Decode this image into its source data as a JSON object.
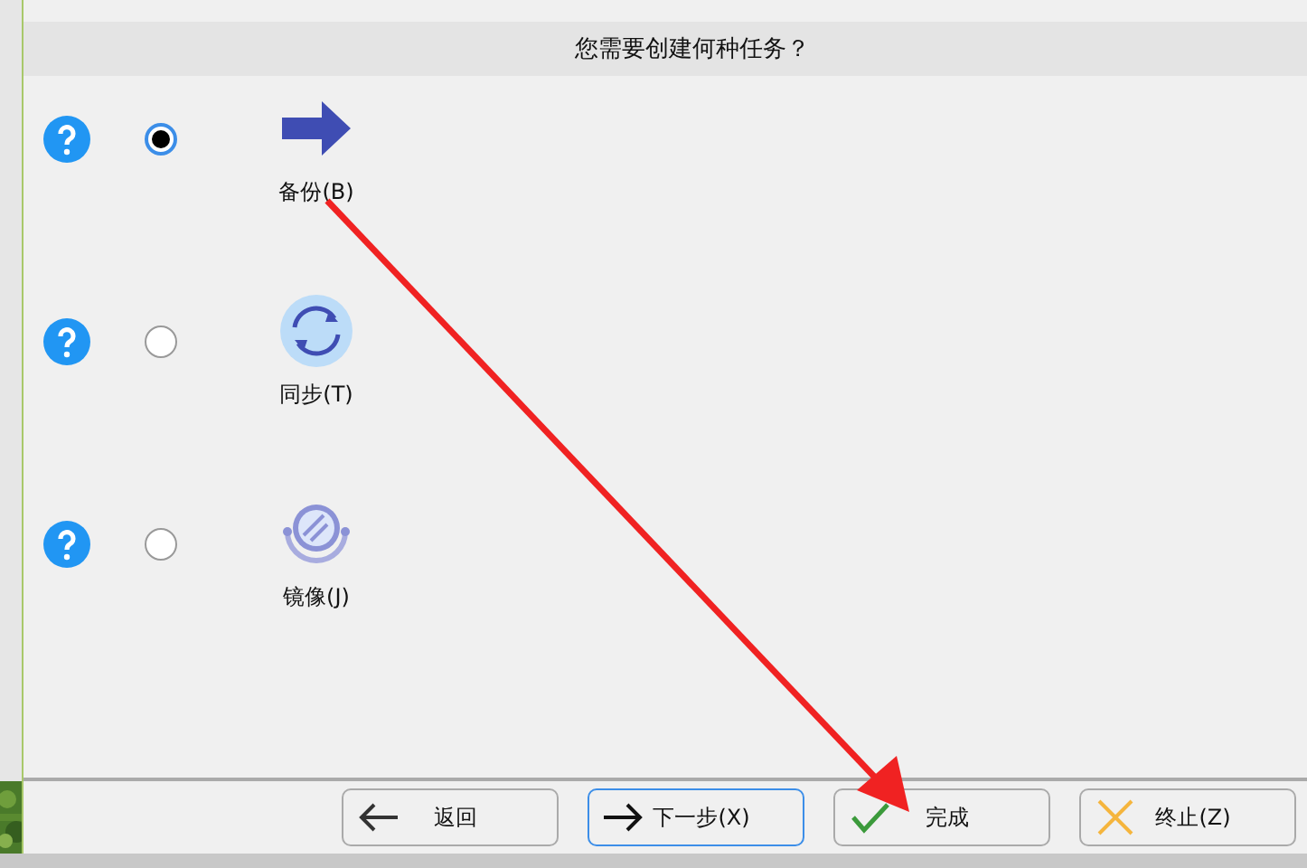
{
  "dialog": {
    "title": "您需要创建何种任务？"
  },
  "options": [
    {
      "kind": "backup",
      "label": "备份(B)",
      "selected": true
    },
    {
      "kind": "sync",
      "label": "同步(T)",
      "selected": false
    },
    {
      "kind": "mirror",
      "label": "镜像(J)",
      "selected": false
    }
  ],
  "buttons": [
    {
      "kind": "back",
      "label": "返回",
      "focused": false
    },
    {
      "kind": "next",
      "label": "下一步(X)",
      "focused": true
    },
    {
      "kind": "finish",
      "label": "完成",
      "focused": false
    },
    {
      "kind": "abort",
      "label": "终止(Z)",
      "focused": false
    }
  ]
}
